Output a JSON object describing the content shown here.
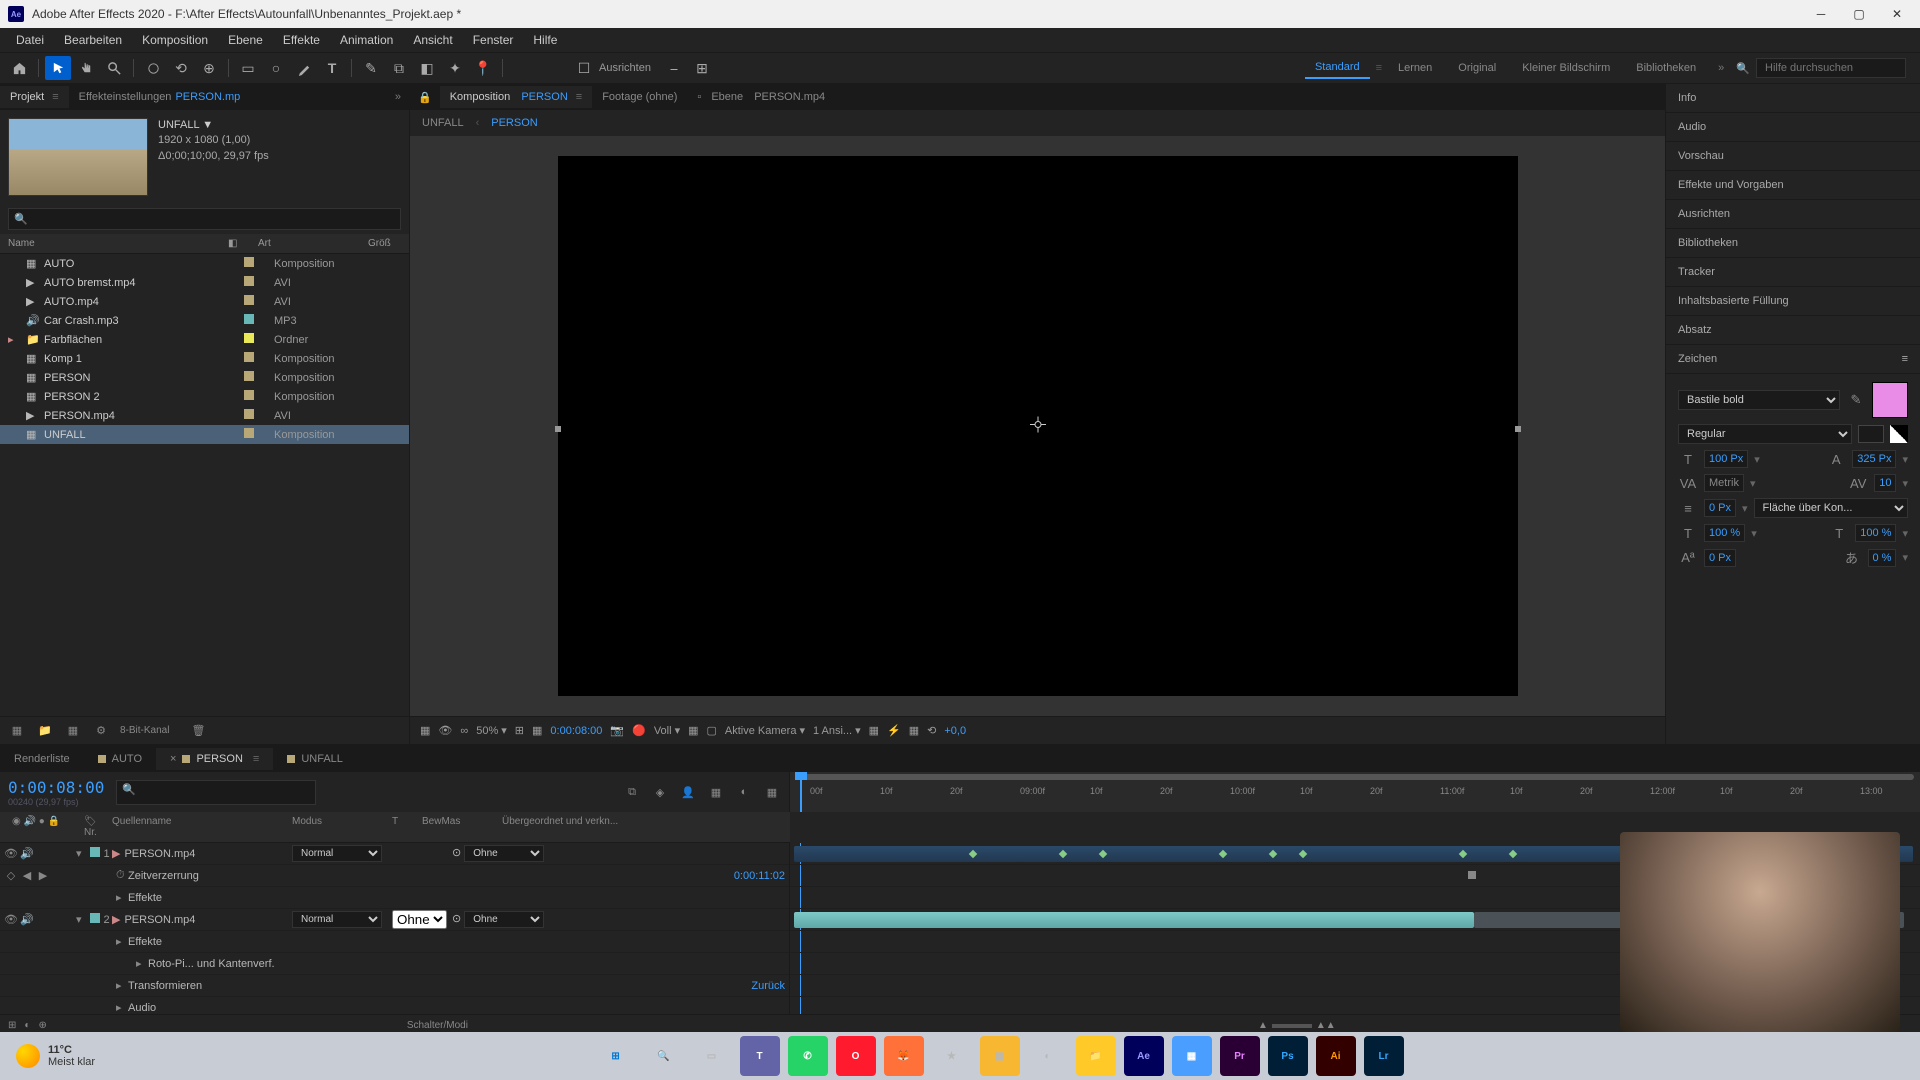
{
  "window": {
    "title": "Adobe After Effects 2020 - F:\\After Effects\\Autounfall\\Unbenanntes_Projekt.aep *",
    "app_icon": "Ae"
  },
  "menu": [
    "Datei",
    "Bearbeiten",
    "Komposition",
    "Ebene",
    "Effekte",
    "Animation",
    "Ansicht",
    "Fenster",
    "Hilfe"
  ],
  "workspaces": {
    "items": [
      "Standard",
      "Lernen",
      "Original",
      "Kleiner Bildschirm",
      "Bibliotheken"
    ],
    "active": "Standard",
    "search_placeholder": "Hilfe durchsuchen"
  },
  "checkbox_label": "Ausrichten",
  "project_panel": {
    "tabs": {
      "projekt": "Projekt",
      "effekt_prefix": "Effekteinstellungen",
      "effekt_link": "PERSON.mp"
    },
    "selected": {
      "name": "UNFALL ▼",
      "dims": "1920 x 1080 (1,00)",
      "dur": "Δ0;00;10;00, 29,97 fps"
    },
    "cols": {
      "name": "Name",
      "art": "Art",
      "grob": "Größ"
    },
    "items": [
      {
        "name": "AUTO",
        "type": "Komposition",
        "icon": "comp",
        "color": "#b8a878"
      },
      {
        "name": "AUTO bremst.mp4",
        "type": "AVI",
        "icon": "vid",
        "color": "#b8a878"
      },
      {
        "name": "AUTO.mp4",
        "type": "AVI",
        "icon": "vid",
        "color": "#b8a878"
      },
      {
        "name": "Car Crash.mp3",
        "type": "MP3",
        "icon": "aud",
        "color": "#68b8b8"
      },
      {
        "name": "Farbflächen",
        "type": "Ordner",
        "icon": "folder",
        "color": "#e8e858"
      },
      {
        "name": "Komp 1",
        "type": "Komposition",
        "icon": "comp",
        "color": "#b8a878"
      },
      {
        "name": "PERSON",
        "type": "Komposition",
        "icon": "comp",
        "color": "#b8a878"
      },
      {
        "name": "PERSON 2",
        "type": "Komposition",
        "icon": "comp",
        "color": "#b8a878"
      },
      {
        "name": "PERSON.mp4",
        "type": "AVI",
        "icon": "vid",
        "color": "#b8a878"
      },
      {
        "name": "UNFALL",
        "type": "Komposition",
        "icon": "comp",
        "color": "#b8a878",
        "selected": true
      }
    ],
    "bpc": "8-Bit-Kanal"
  },
  "comp_panel": {
    "tabs": {
      "comp_prefix": "Komposition",
      "comp_link": "PERSON",
      "footage": "Footage  (ohne)",
      "layer_prefix": "Ebene",
      "layer_link": "PERSON.mp4"
    },
    "breadcrumb": [
      "UNFALL",
      "PERSON"
    ],
    "zoom": "50%",
    "time": "0:00:08:00",
    "channel": "Voll",
    "camera": "Aktive Kamera",
    "views": "1 Ansi...",
    "expo": "+0,0"
  },
  "right_panels": [
    "Info",
    "Audio",
    "Vorschau",
    "Effekte und Vorgaben",
    "Ausrichten",
    "Bibliotheken",
    "Tracker",
    "Inhaltsbasierte Füllung",
    "Absatz"
  ],
  "char_panel": {
    "title": "Zeichen",
    "font": "Bastile bold",
    "style": "Regular",
    "size": "100 Px",
    "leading": "325 Px",
    "kerning": "Metrik",
    "tracking": "10",
    "stroke": "0 Px",
    "fill_method": "Fläche über Kon...",
    "vscale": "100 %",
    "hscale": "100 %",
    "baseline": "0 Px",
    "tsume": "0 %"
  },
  "timeline": {
    "tabs": [
      {
        "name": "Renderliste"
      },
      {
        "name": "AUTO",
        "color": "#b8a878"
      },
      {
        "name": "PERSON",
        "color": "#b8a878",
        "active": true
      },
      {
        "name": "UNFALL",
        "color": "#b8a878"
      }
    ],
    "timecode": "0:00:08:00",
    "frames_hint": "00240 (29,97 fps)",
    "cols": {
      "nr": "Nr.",
      "quelle": "Quellenname",
      "modus": "Modus",
      "t": "T",
      "bewmas": "BewMas",
      "parent": "Übergeordnet und verkn..."
    },
    "ruler_ticks": [
      "00f",
      "10f",
      "20f",
      "09:00f",
      "10f",
      "20f",
      "10:00f",
      "10f",
      "20f",
      "11:00f",
      "10f",
      "20f",
      "12:00f",
      "10f",
      "20f",
      "13:00"
    ],
    "layers": [
      {
        "num": "1",
        "name": "PERSON.mp4",
        "color": "#68b8b8",
        "modus": "Normal",
        "parent": "Ohne"
      },
      {
        "prop": "Zeitverzerrung",
        "value": "0:00:11:02"
      },
      {
        "prop": "Effekte"
      },
      {
        "num": "2",
        "name": "PERSON.mp4",
        "color": "#68b8b8",
        "modus": "Normal",
        "trk": "Ohne",
        "parent": "Ohne"
      },
      {
        "prop": "Effekte"
      },
      {
        "prop": "Roto-Pi... und Kantenverf."
      },
      {
        "prop": "Transformieren",
        "value": "Zurück"
      },
      {
        "prop": "Audio"
      }
    ],
    "footer_mode": "Schalter/Modi"
  },
  "taskbar": {
    "temp": "11°C",
    "cond": "Meist klar"
  }
}
